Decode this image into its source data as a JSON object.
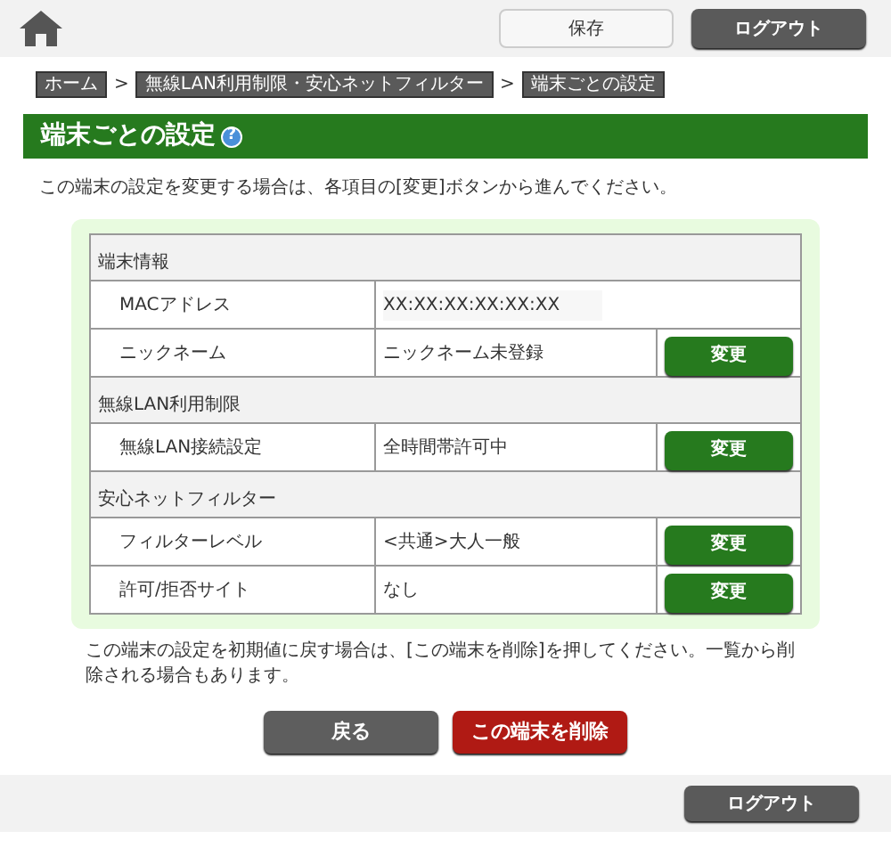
{
  "header": {
    "save_button": "保存",
    "logout_button": "ログアウト"
  },
  "breadcrumbs": [
    "ホーム",
    "無線LAN利用制限・安心ネットフィルター",
    "端末ごとの設定"
  ],
  "breadcrumb_separator": ">",
  "page_title": "端末ごとの設定",
  "help_icon": "?",
  "intro": "この端末の設定を変更する場合は、各項目の[変更]ボタンから進んでください。",
  "table": {
    "rows": [
      {
        "kind": "section",
        "label": "端末情報"
      },
      {
        "kind": "item",
        "label": "MACアドレス",
        "value": "XX:XX:XX:XX:XX:XX"
      },
      {
        "kind": "item",
        "label": "ニックネーム",
        "value": "ニックネーム未登録",
        "button": "変更"
      },
      {
        "kind": "section",
        "label": "無線LAN利用制限"
      },
      {
        "kind": "item",
        "label": "無線LAN接続設定",
        "value": "全時間帯許可中",
        "button": "変更"
      },
      {
        "kind": "section",
        "label": "安心ネットフィルター"
      },
      {
        "kind": "item",
        "label": "フィルターレベル",
        "value": "<共通>大人一般",
        "button": "変更"
      },
      {
        "kind": "item",
        "label": "許可/拒否サイト",
        "value": "なし",
        "button": "変更"
      }
    ]
  },
  "note": "この端末の設定を初期値に戻す場合は、[この端末を削除]を押してください。一覧から削除される場合もあります。",
  "back_button": "戻る",
  "delete_button": "この端末を削除",
  "footer": {
    "logout_button": "ログアウト"
  }
}
